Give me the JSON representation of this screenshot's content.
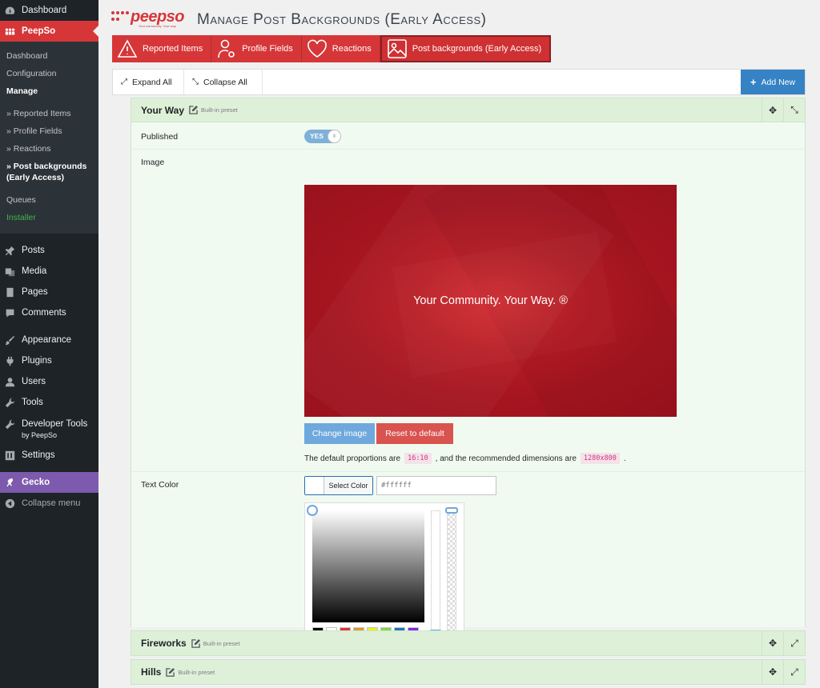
{
  "sidebar": {
    "top_items": [
      {
        "label": "Dashboard",
        "icon": "dashboard-icon"
      },
      {
        "label": "PeepSo",
        "icon": "peepso-icon"
      }
    ],
    "submenu": [
      "Dashboard",
      "Configuration",
      "Manage",
      "» Reported Items",
      "» Profile Fields",
      "» Reactions",
      "» Post backgrounds (Early Access)",
      "Queues",
      "Installer"
    ],
    "menu_items": [
      {
        "label": "Posts",
        "icon": "pin-icon"
      },
      {
        "label": "Media",
        "icon": "media-icon"
      },
      {
        "label": "Pages",
        "icon": "pages-icon"
      },
      {
        "label": "Comments",
        "icon": "comments-icon"
      },
      {
        "label": "Appearance",
        "icon": "brush-icon"
      },
      {
        "label": "Plugins",
        "icon": "plugin-icon"
      },
      {
        "label": "Users",
        "icon": "user-icon"
      },
      {
        "label": "Tools",
        "icon": "wrench-icon"
      },
      {
        "label": "Developer Tools",
        "sublabel": "by PeepSo",
        "icon": "wrench-icon"
      },
      {
        "label": "Settings",
        "icon": "settings-icon"
      },
      {
        "label": "Gecko",
        "icon": "gecko-icon"
      },
      {
        "label": "Collapse menu",
        "icon": "collapse-icon"
      }
    ]
  },
  "header": {
    "logo_text": "peepso",
    "logo_tagline": "Your community. Your way.",
    "title": "Manage Post Backgrounds (Early Access)"
  },
  "tabs": [
    {
      "label": "Reported Items",
      "icon": "warning-icon"
    },
    {
      "label": "Profile Fields",
      "icon": "user-gear-icon"
    },
    {
      "label": "Reactions",
      "icon": "heart-icon"
    },
    {
      "label": "Post backgrounds (Early Access)",
      "icon": "image-icon"
    }
  ],
  "toolbar": {
    "expand_label": "Expand All",
    "collapse_label": "Collapse All",
    "add_new_label": "Add New"
  },
  "panels": [
    {
      "title": "Your Way",
      "badge": "Built-in preset"
    },
    {
      "title": "Fireworks",
      "badge": "Built-in preset"
    },
    {
      "title": "Hills",
      "badge": "Built-in preset"
    }
  ],
  "form": {
    "published_label": "Published",
    "toggle_text": "YES",
    "image_label": "Image",
    "preview_text": "Your Community. Your Way. ®",
    "change_image_label": "Change image",
    "reset_label": "Reset to default",
    "hint_prefix": "The default proportions are",
    "hint_ratio": "16:10",
    "hint_middle": ", and the recommended dimensions are",
    "hint_dims": "1280x800",
    "hint_suffix": ".",
    "text_color_label": "Text Color",
    "select_color_label": "Select Color",
    "color_placeholder": "#ffffff"
  },
  "palette_colors": [
    "#000000",
    "#ffffff",
    "#dd3333",
    "#dd9933",
    "#eeee22",
    "#81d742",
    "#1e73be",
    "#8224e3"
  ],
  "accent_color": "#d63638"
}
